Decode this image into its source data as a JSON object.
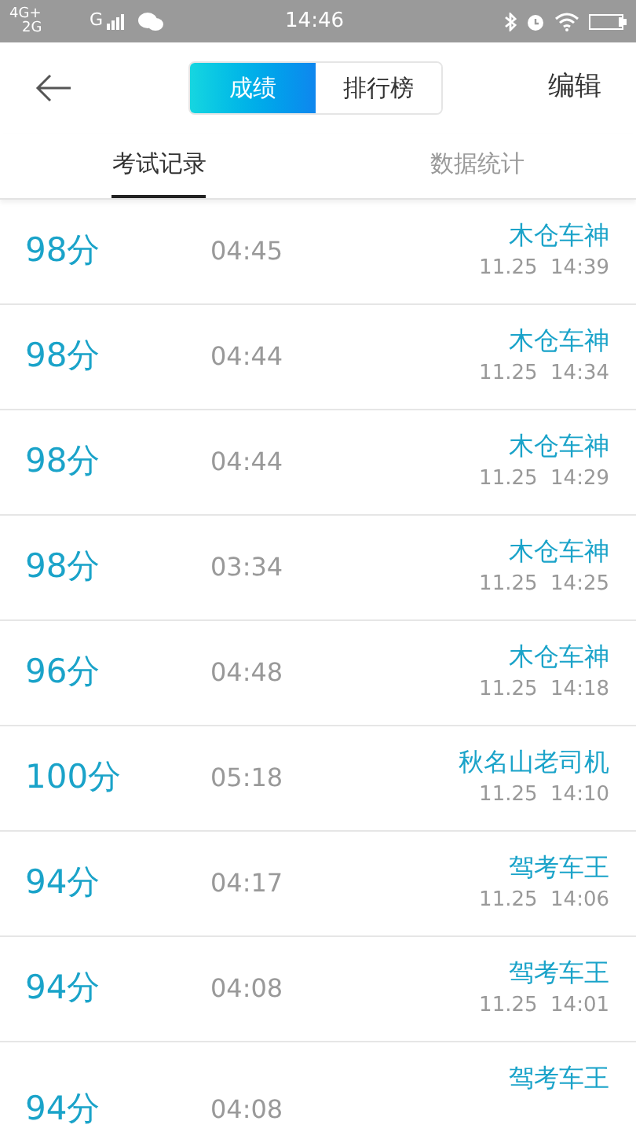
{
  "status_bar": {
    "network_top": "4G+",
    "network_bottom": "2G",
    "network_2": "G",
    "time": "14:46"
  },
  "header": {
    "segments": [
      {
        "label": "成绩",
        "selected": true
      },
      {
        "label": "排行榜",
        "selected": false
      }
    ],
    "action": "编辑"
  },
  "tabs": [
    {
      "label": "考试记录",
      "selected": true
    },
    {
      "label": "数据统计",
      "selected": false
    }
  ],
  "records": [
    {
      "score": "98分",
      "duration": "04:45",
      "name": "木仓车神",
      "date": "11.25  14:39"
    },
    {
      "score": "98分",
      "duration": "04:44",
      "name": "木仓车神",
      "date": "11.25  14:34"
    },
    {
      "score": "98分",
      "duration": "04:44",
      "name": "木仓车神",
      "date": "11.25  14:29"
    },
    {
      "score": "98分",
      "duration": "03:34",
      "name": "木仓车神",
      "date": "11.25  14:25"
    },
    {
      "score": "96分",
      "duration": "04:48",
      "name": "木仓车神",
      "date": "11.25  14:18"
    },
    {
      "score": "100分",
      "duration": "05:18",
      "name": "秋名山老司机",
      "date": "11.25  14:10"
    },
    {
      "score": "94分",
      "duration": "04:17",
      "name": "驾考车王",
      "date": "11.25  14:06"
    },
    {
      "score": "94分",
      "duration": "04:08",
      "name": "驾考车王",
      "date": "11.25  14:01"
    },
    {
      "score": "94分",
      "duration": "04:08",
      "name": "驾考车王"
    }
  ]
}
